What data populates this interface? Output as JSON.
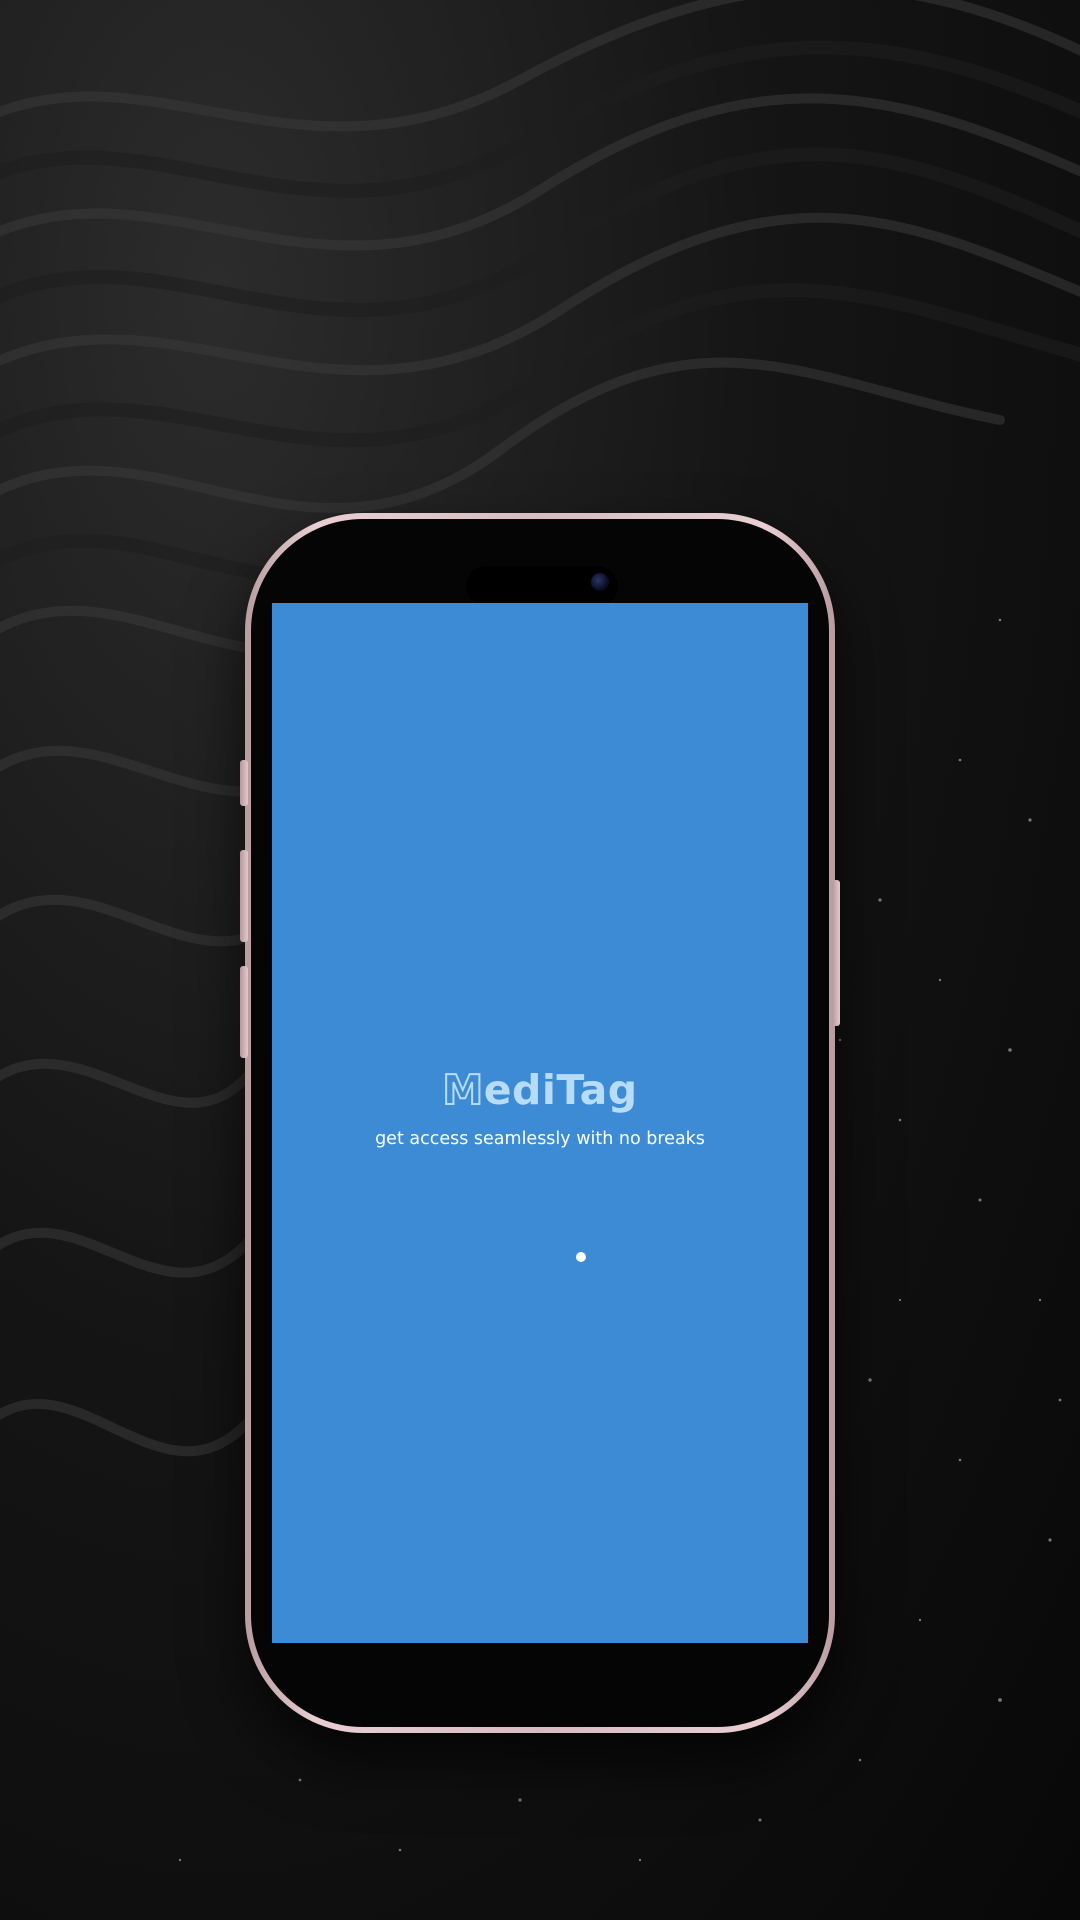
{
  "splash": {
    "logo_first_letter": "M",
    "logo_rest": "ediTag",
    "tagline": "get access seamlessly with no breaks"
  },
  "colors": {
    "screen_background": "#3d8bd4",
    "logo": "#b7dcf7",
    "tagline": "#ffffff",
    "phone_frame": "#e9cfd2"
  }
}
